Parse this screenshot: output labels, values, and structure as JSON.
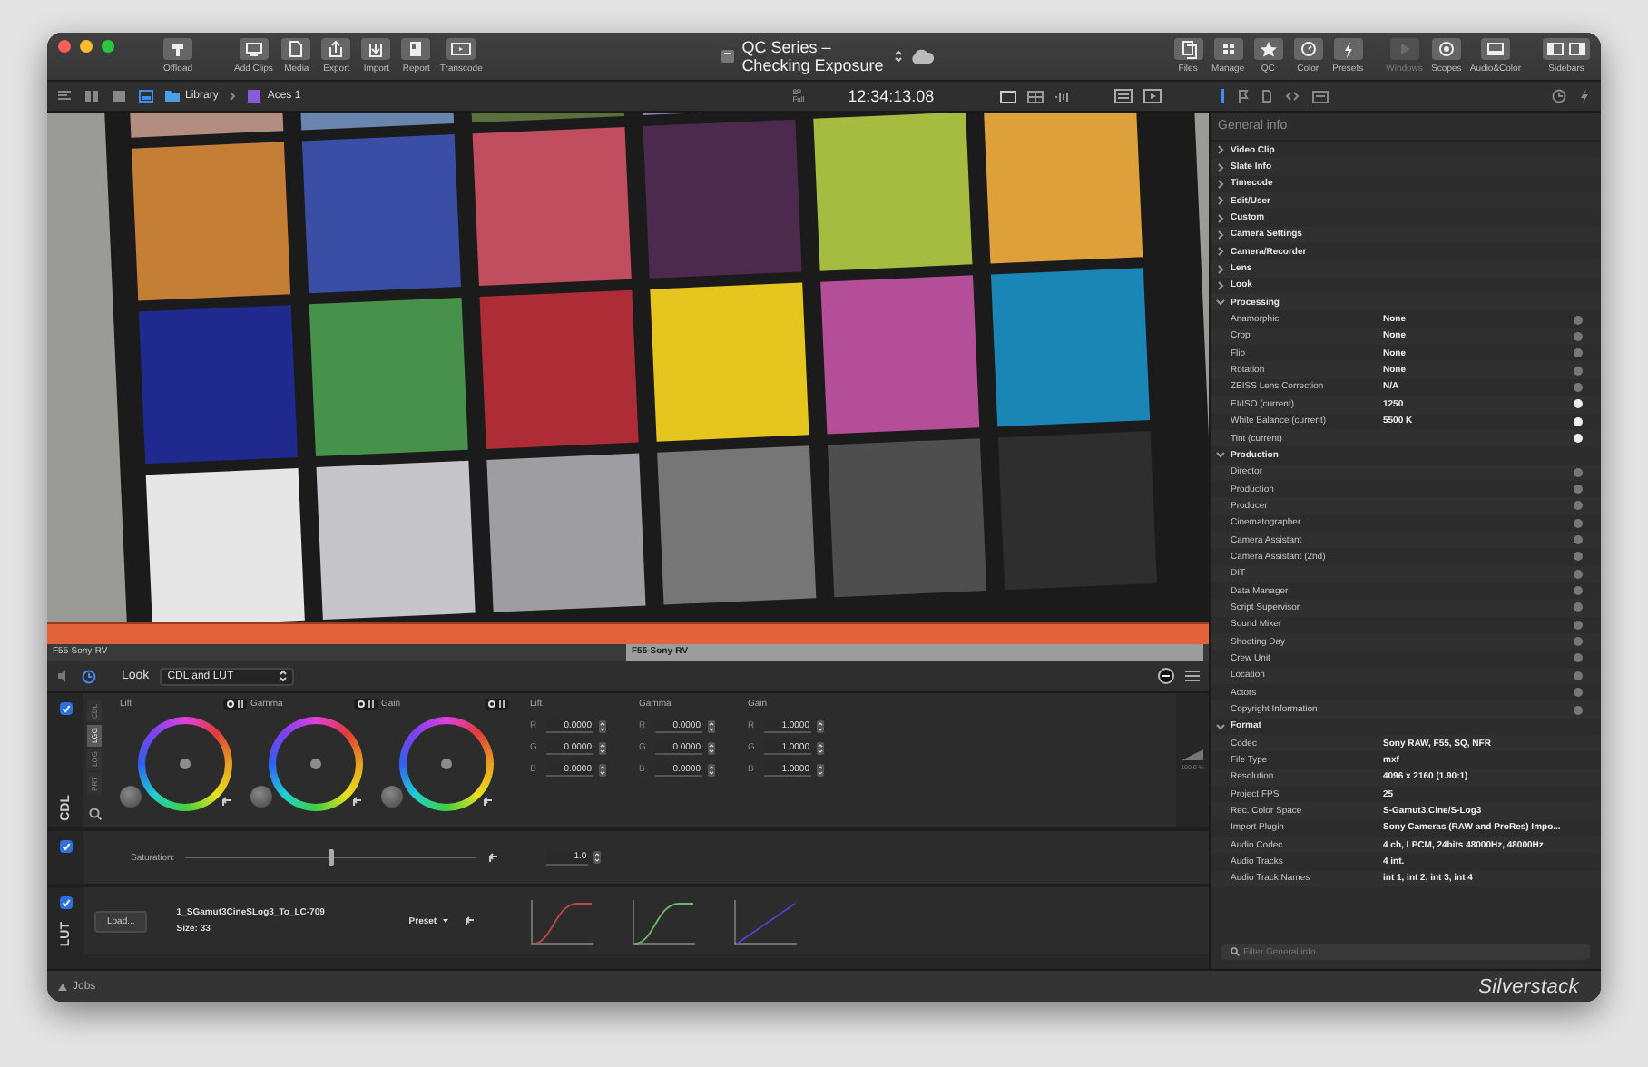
{
  "window": {
    "title": "QC Series – Checking Exposure"
  },
  "toolbar": {
    "left": [
      {
        "label": "Offload"
      },
      {
        "label": "Add Clips"
      },
      {
        "label": "Media"
      },
      {
        "label": "Export"
      },
      {
        "label": "Import"
      },
      {
        "label": "Report"
      },
      {
        "label": "Transcode"
      }
    ],
    "right": [
      {
        "label": "Files",
        "disabled": false
      },
      {
        "label": "Manage",
        "disabled": false
      },
      {
        "label": "QC",
        "disabled": false
      },
      {
        "label": "Color",
        "disabled": false
      },
      {
        "label": "Presets",
        "disabled": false
      },
      {
        "label": "Windows",
        "disabled": true
      },
      {
        "label": "Scopes",
        "disabled": false
      },
      {
        "label": "Audio&Color",
        "disabled": false
      },
      {
        "label": "Sidebars",
        "disabled": false
      }
    ]
  },
  "path_bar": {
    "view_modes": [
      {
        "selected": false
      },
      {
        "selected": false
      },
      {
        "selected": false
      },
      {
        "selected": true
      }
    ],
    "breadcrumb": [
      "Library",
      "Aces 1"
    ],
    "quality": [
      "8P",
      "Full"
    ],
    "timecode": "12:34:13.08"
  },
  "timeline": {
    "clip_labels": [
      {
        "text": "F55-Sony-RV",
        "selected": false
      },
      {
        "text": "F55-Sony-RV",
        "selected": true
      }
    ]
  },
  "look": {
    "label": "Look",
    "preset": "CDL and LUT"
  },
  "cdl": {
    "enabled": true,
    "section_label": "CDL",
    "mode_tabs": [
      {
        "label": "CDL",
        "selected": false
      },
      {
        "label": "LGG",
        "selected": true
      },
      {
        "label": "LOG",
        "selected": false
      },
      {
        "label": "PRT",
        "selected": false
      }
    ],
    "wheels": [
      {
        "label": "Lift"
      },
      {
        "label": "Gamma"
      },
      {
        "label": "Gain"
      }
    ],
    "value_columns": [
      {
        "label": "Lift",
        "values": [
          {
            "channel": "R",
            "value": "0.0000"
          },
          {
            "channel": "G",
            "value": "0.0000"
          },
          {
            "channel": "B",
            "value": "0.0000"
          }
        ]
      },
      {
        "label": "Gamma",
        "values": [
          {
            "channel": "R",
            "value": "0.0000"
          },
          {
            "channel": "G",
            "value": "0.0000"
          },
          {
            "channel": "B",
            "value": "0.0000"
          }
        ]
      },
      {
        "label": "Gain",
        "values": [
          {
            "channel": "R",
            "value": "1.0000"
          },
          {
            "channel": "G",
            "value": "1.0000"
          },
          {
            "channel": "B",
            "value": "1.0000"
          }
        ]
      }
    ],
    "meter_reading": "100.0 %"
  },
  "saturation": {
    "enabled": true,
    "label": "Saturation:",
    "level": 0.5,
    "value": "1.0"
  },
  "lut": {
    "enabled": true,
    "section_label": "LUT",
    "load_button": "Load...",
    "name": "1_SGamut3CineSLog3_To_LC-709",
    "size": "Size: 33",
    "preset": "Preset"
  },
  "panel": {
    "title": "General info",
    "groups": [
      {
        "label": "Video Clip",
        "expanded": false
      },
      {
        "label": "Slate Info",
        "expanded": false
      },
      {
        "label": "Timecode",
        "expanded": false
      },
      {
        "label": "Edit/User",
        "expanded": false
      },
      {
        "label": "Custom",
        "expanded": false
      },
      {
        "label": "Camera Settings",
        "expanded": false
      },
      {
        "label": "Camera/Recorder",
        "expanded": false
      },
      {
        "label": "Lens",
        "expanded": false
      },
      {
        "label": "Look",
        "expanded": false
      },
      {
        "label": "Processing",
        "expanded": true,
        "rows": [
          {
            "label": "Anamorphic",
            "value": "None",
            "kind": "field",
            "active": false
          },
          {
            "label": "Crop",
            "value": "None",
            "kind": "field",
            "active": false
          },
          {
            "label": "Flip",
            "value": "None",
            "kind": "field",
            "active": false
          },
          {
            "label": "Rotation",
            "value": "None",
            "kind": "field",
            "active": false
          },
          {
            "label": "ZEISS Lens Correction",
            "value": "N/A",
            "kind": "field",
            "active": false
          },
          {
            "label": "EI/ISO (current)",
            "value": "1250",
            "kind": "field",
            "active": true
          },
          {
            "label": "White Balance (current)",
            "value": "5500 K",
            "kind": "field",
            "active": true
          },
          {
            "label": "Tint (current)",
            "kind": "field",
            "active": true
          }
        ]
      },
      {
        "label": "Production",
        "expanded": true,
        "rows": [
          {
            "label": "Director",
            "kind": "field",
            "active": false
          },
          {
            "label": "Production",
            "kind": "field",
            "active": false
          },
          {
            "label": "Producer",
            "kind": "field",
            "active": false
          },
          {
            "label": "Cinematographer",
            "kind": "field",
            "active": false
          },
          {
            "label": "Camera Assistant",
            "kind": "field",
            "active": false
          },
          {
            "label": "Camera Assistant (2nd)",
            "kind": "field",
            "active": false
          },
          {
            "label": "DIT",
            "kind": "field",
            "active": false
          },
          {
            "label": "Data Manager",
            "kind": "field",
            "active": false
          },
          {
            "label": "Script Supervisor",
            "kind": "field",
            "active": false
          },
          {
            "label": "Sound Mixer",
            "kind": "field",
            "active": false
          },
          {
            "label": "Shooting Day",
            "kind": "field",
            "active": false
          },
          {
            "label": "Crew Unit",
            "kind": "field",
            "active": false
          },
          {
            "label": "Location",
            "kind": "field",
            "active": false
          },
          {
            "label": "Actors",
            "kind": "field",
            "active": false
          },
          {
            "label": "Copyright Information",
            "kind": "field",
            "active": false
          }
        ]
      },
      {
        "label": "Format",
        "expanded": true,
        "rows": [
          {
            "label": "Codec",
            "value": "Sony RAW, F55, SQ, NFR",
            "kind": "info"
          },
          {
            "label": "File Type",
            "value": "mxf",
            "kind": "info"
          },
          {
            "label": "Resolution",
            "value": "4096 x 2160 (1.90:1)",
            "kind": "info"
          },
          {
            "label": "Project FPS",
            "value": "25",
            "kind": "info"
          },
          {
            "label": "Rec. Color Space",
            "value": "S-Gamut3.Cine/S-Log3",
            "kind": "info"
          },
          {
            "label": "Import Plugin",
            "value": "Sony Cameras (RAW and ProRes) Impo...",
            "kind": "info"
          },
          {
            "label": "Audio Codec",
            "value": "4 ch, LPCM, 24bits 48000Hz, 48000Hz",
            "kind": "info"
          },
          {
            "label": "Audio Tracks",
            "value": "4 int.",
            "kind": "info"
          },
          {
            "label": "Audio Track Names",
            "value": "int 1, int 2, int 3, int 4",
            "kind": "info"
          }
        ]
      }
    ],
    "filter_placeholder": "Filter General info"
  },
  "status_bar": {
    "jobs": "Jobs",
    "brand": "Silverstack"
  }
}
